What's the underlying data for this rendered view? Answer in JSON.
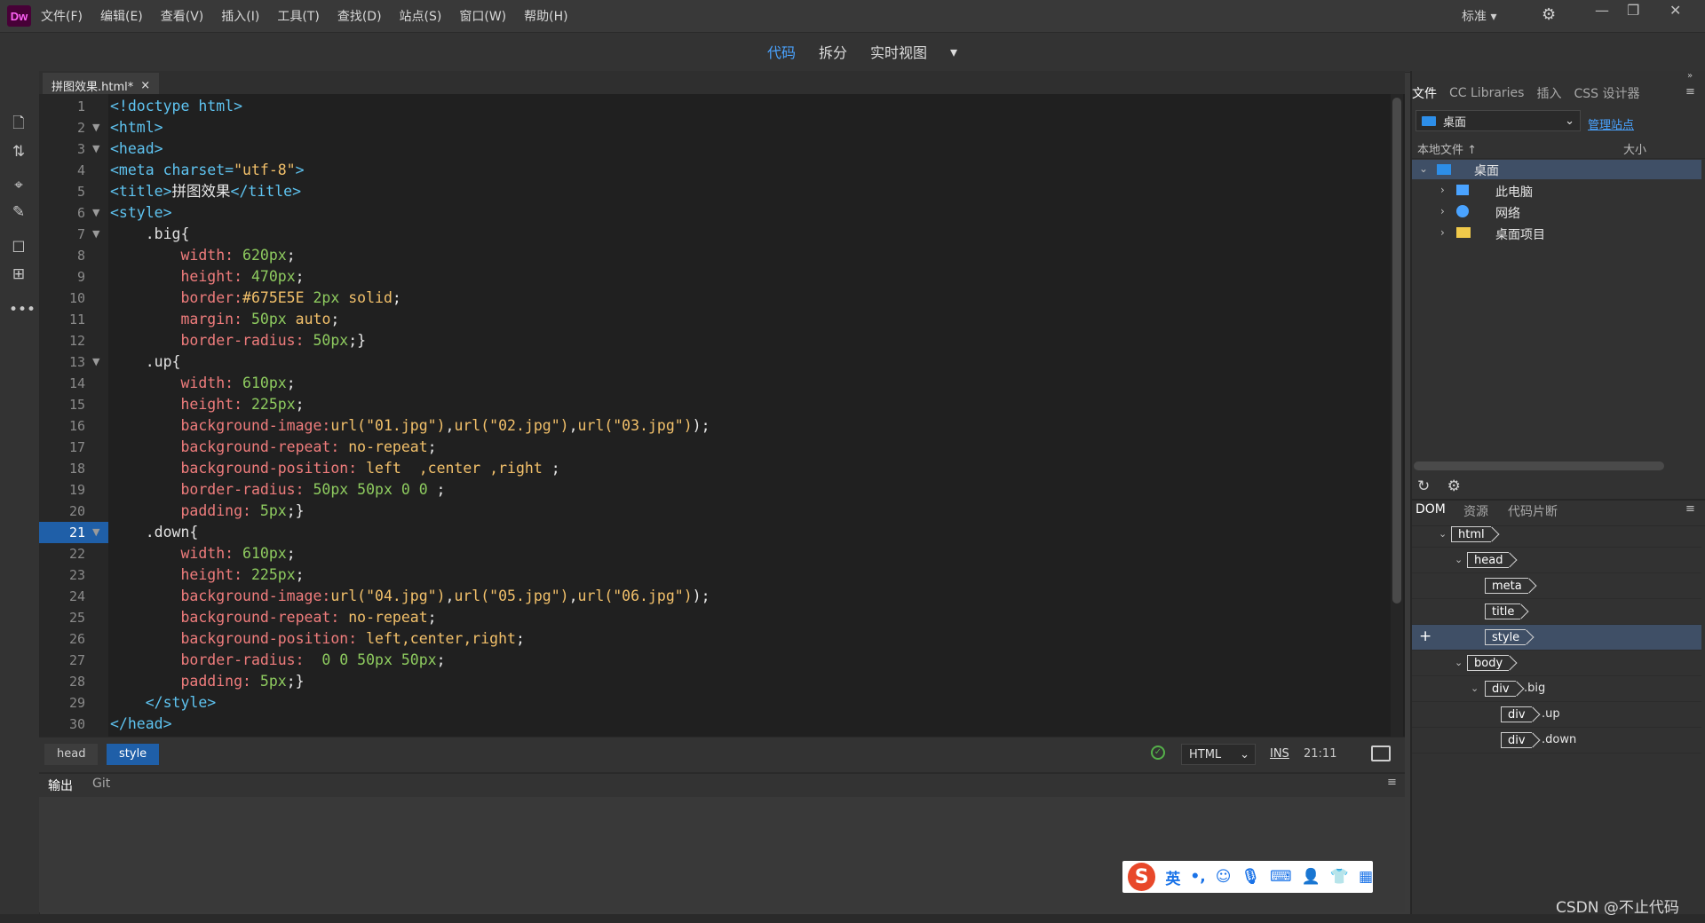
{
  "app": {
    "logo": "Dw"
  },
  "menubar": {
    "items": [
      "文件(F)",
      "编辑(E)",
      "查看(V)",
      "插入(I)",
      "工具(T)",
      "查找(D)",
      "站点(S)",
      "窗口(W)",
      "帮助(H)"
    ],
    "workspace": "标准",
    "settings_icon": "gear-sync-icon"
  },
  "viewbar": {
    "code": "代码",
    "split": "拆分",
    "live": "实时视图"
  },
  "document": {
    "tab": "拼图效果.html*",
    "close": "×"
  },
  "editor": {
    "line_numbers": [
      "1",
      "2",
      "3",
      "4",
      "5",
      "6",
      "7",
      "8",
      "9",
      "10",
      "11",
      "12",
      "13",
      "14",
      "15",
      "16",
      "17",
      "18",
      "19",
      "20",
      "21",
      "22",
      "23",
      "24",
      "25",
      "26",
      "27",
      "28",
      "29",
      "30"
    ],
    "current_line": "21",
    "lines": [
      [
        "<!doctype html>"
      ],
      [
        "<html>"
      ],
      [
        "<head>"
      ],
      [
        "<meta charset=",
        "\"utf-8\"",
        ">"
      ],
      [
        "<title>",
        "拼图效果",
        "</title>"
      ],
      [
        "<style>"
      ],
      [
        "    .big{"
      ],
      [
        "        width: ",
        "620px",
        ";"
      ],
      [
        "        height: ",
        "470px",
        ";"
      ],
      [
        "        border:",
        "#675E5E",
        " 2px",
        " solid",
        ";"
      ],
      [
        "        margin: ",
        "50px",
        " auto",
        ";"
      ],
      [
        "        border-radius: ",
        "50px",
        ";}"
      ],
      [
        "    .up{"
      ],
      [
        "        width: ",
        "610px",
        ";"
      ],
      [
        "        height: ",
        "225px",
        ";"
      ],
      [
        "        background-image:",
        "url(\"01.jpg\")",
        ",",
        "url(\"02.jpg\")",
        ",",
        "url(\"03.jpg\")",
        ");"
      ],
      [
        "        background-repeat: ",
        "no-repeat",
        ";"
      ],
      [
        "        background-position: ",
        "left  ,center ,right ",
        ";"
      ],
      [
        "        border-radius: ",
        "50px 50px 0 0",
        " ;"
      ],
      [
        "        padding: ",
        "5px",
        ";}"
      ],
      [
        "    .down",
        "{"
      ],
      [
        "        width: ",
        "610px",
        ";"
      ],
      [
        "        height: ",
        "225px",
        ";"
      ],
      [
        "        background-image:",
        "url(\"04.jpg\")",
        ",",
        "url(\"05.jpg\")",
        ",",
        "url(\"06.jpg\")",
        ");"
      ],
      [
        "        background-repeat: ",
        "no-repeat",
        ";"
      ],
      [
        "        background-position: ",
        "left,center,right",
        ";"
      ],
      [
        "        border-radius:  ",
        "0 0 50px 50px",
        ";"
      ],
      [
        "        padding: ",
        "5px",
        ";}"
      ],
      [
        "    </style>"
      ],
      [
        "</head>"
      ]
    ]
  },
  "statusbar": {
    "crumbs": [
      "head",
      "style"
    ],
    "language": "HTML",
    "mode": "INS",
    "position": "21:11"
  },
  "output": {
    "tabs": [
      "输出",
      "Git"
    ]
  },
  "rightpanel": {
    "tabs": [
      "文件",
      "CC Libraries",
      "插入",
      "CSS 设计器"
    ],
    "site": "桌面",
    "manage_site": "管理站点",
    "col_local": "本地文件",
    "col_size": "大小",
    "tree": [
      {
        "label": "桌面",
        "icon": "desktop-icon"
      },
      {
        "label": "此电脑",
        "icon": "computer-icon"
      },
      {
        "label": "网络",
        "icon": "network-icon"
      },
      {
        "label": "桌面项目",
        "icon": "folder-icon"
      }
    ],
    "dom_tabs": [
      "DOM",
      "资源",
      "代码片断"
    ],
    "dom_tree": [
      {
        "tag": "html",
        "cls": ""
      },
      {
        "tag": "head",
        "cls": ""
      },
      {
        "tag": "meta",
        "cls": ""
      },
      {
        "tag": "title",
        "cls": ""
      },
      {
        "tag": "style",
        "cls": ""
      },
      {
        "tag": "body",
        "cls": ""
      },
      {
        "tag": "div",
        "cls": ".big"
      },
      {
        "tag": "div",
        "cls": ".up"
      },
      {
        "tag": "div",
        "cls": ".down"
      }
    ]
  },
  "ime": {
    "lang": "英",
    "punct": "•,"
  },
  "watermark": "CSDN @不止代码"
}
